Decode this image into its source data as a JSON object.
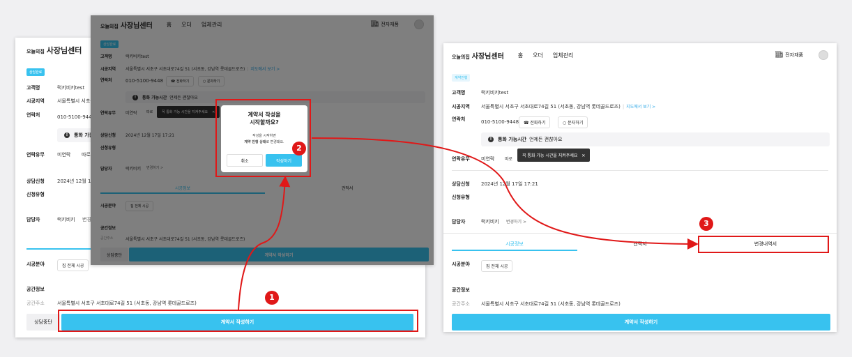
{
  "header": {
    "logo_small": "오늘의집",
    "logo_title": "사장님센터",
    "nav": [
      "홈",
      "오더",
      "업체관리"
    ],
    "e_contract": "전자재품"
  },
  "icons": {
    "e_contract": "store-icon",
    "phone": "phone-icon",
    "message": "chat-icon",
    "info": "info-icon"
  },
  "colors": {
    "accent": "#38c2ef",
    "highlight": "#e01818",
    "overlay": "#000000"
  },
  "screens": [
    {
      "badge": "상담완료"
    },
    {
      "badge": "상담완료"
    },
    {
      "badge": "계약진행"
    }
  ],
  "customer": {
    "name_label": "고객명",
    "name": "럭키비키test",
    "area_label": "시공지역",
    "address": "서울특별시 서초구 서초대로74길 51 (서초동, 강남역 롯데골드로즈)",
    "map_link": "지도에서 보기 >",
    "contact_label": "연락처",
    "phone": "010-5100-9448",
    "call_button": "전화하기",
    "message_button": "문자하기",
    "available_label": "통화 가능시간",
    "available_value": "언제든 괜찮아요",
    "tooltip": "꼭 통화 가능 시간을 지켜주세요",
    "reach_label": "연락유무",
    "reach_value": "미연락",
    "reach_extra": "따로",
    "consult_label": "상담신청",
    "consult_date": "2024년 12월 17일 17:21",
    "type_label": "신청유형",
    "manager_label": "담당자",
    "manager": "럭키비키",
    "manager_change": "변경하기 >"
  },
  "tabs": [
    "시공정보",
    "견적서",
    "변경내역서"
  ],
  "construction": {
    "field_label": "시공분야",
    "field_chip": "집 전체 시공",
    "space_label": "공간정보",
    "address_label": "공간주소",
    "address": "서울특별시 서초구 서초대로74길 51 (서초동, 강남역 롯데골드로즈)"
  },
  "actions": {
    "stop": "상담중단",
    "write_contract": "계약서 작성하기"
  },
  "modal": {
    "title_line1": "계약서 작성을",
    "title_line2": "시작할까요?",
    "desc_line1": "작성을 시작하면",
    "desc_bold": "계약 진행 상태",
    "desc_rest": "로 변경돼요.",
    "cancel": "취소",
    "confirm": "작성하기"
  },
  "steps": [
    "1",
    "2",
    "3"
  ]
}
